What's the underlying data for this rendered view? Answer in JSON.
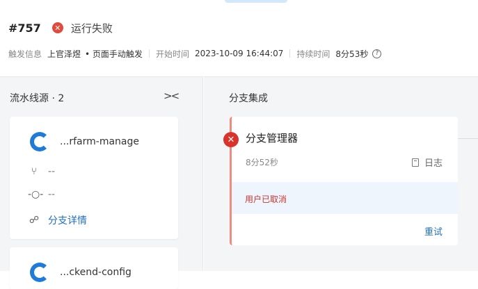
{
  "run": {
    "id": "#757",
    "status": "运行失败"
  },
  "meta": {
    "trigger_label": "触发信息",
    "trigger_user": "上官泽煜",
    "trigger_source": "• 页面手动触发",
    "start_label": "开始时间",
    "start_time": "2023-10-09 16:44:07",
    "duration_label": "持续时间",
    "duration": "8分53秒",
    "help": "?"
  },
  "sources": {
    "title": "流水线源 · 2",
    "collapse": "><",
    "items": [
      {
        "name": "...rfarm-manage",
        "branch": "--",
        "commit": "--",
        "detail_link": "分支详情"
      },
      {
        "name": "...ckend-config"
      }
    ]
  },
  "stage": {
    "title": "分支集成",
    "job": {
      "name": "分支管理器",
      "duration": "8分52秒",
      "log_label": "日志",
      "message": "用户已取消",
      "retry_label": "重试",
      "error_icon": "close-icon"
    }
  },
  "colors": {
    "error": "#d9342b",
    "link": "#1f6fc5",
    "accent": "#1f7bd8"
  }
}
